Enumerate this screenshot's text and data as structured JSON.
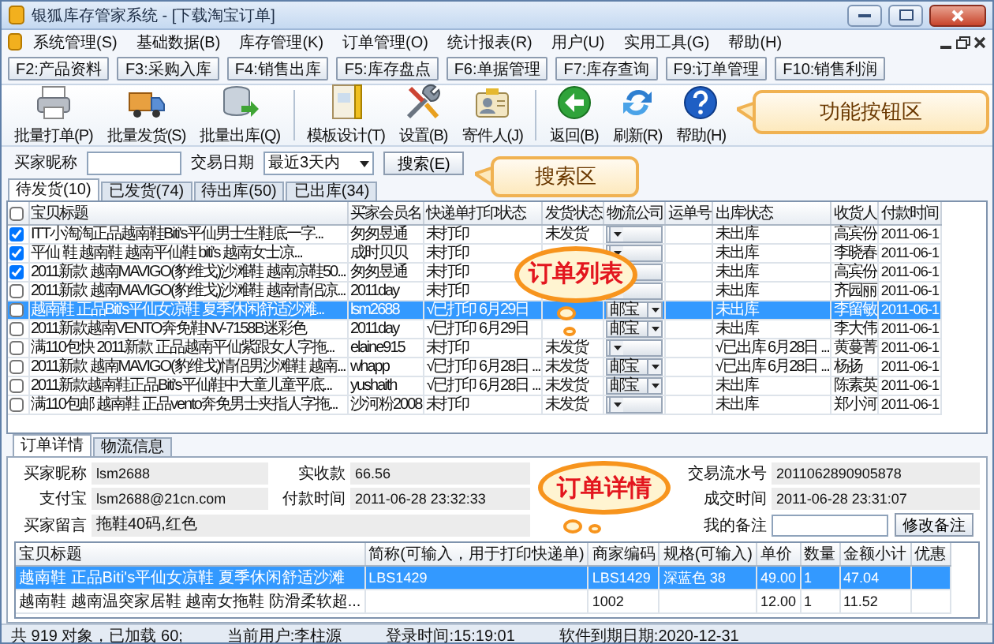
{
  "window": {
    "title": "银狐库存管家系统 - [下载淘宝订单]"
  },
  "menu": [
    "系统管理(S)",
    "基础数据(B)",
    "库存管理(K)",
    "订单管理(O)",
    "统计报表(R)",
    "用户(U)",
    "实用工具(G)",
    "帮助(H)"
  ],
  "function_keys": [
    "F2:产品资料",
    "F3:采购入库",
    "F4:销售出库",
    "F5:库存盘点",
    "F6:单据管理",
    "F7:库存查询",
    "F9:订单管理",
    "F10:销售利润"
  ],
  "toolbar": [
    [
      {
        "label": "批量打单(P)"
      },
      {
        "label": "批量发货(S)"
      },
      {
        "label": "批量出库(Q)"
      }
    ],
    [
      {
        "label": "模板设计(T)"
      },
      {
        "label": "设置(B)"
      },
      {
        "label": "寄件人(J)"
      }
    ],
    [
      {
        "label": "返回(B)"
      },
      {
        "label": "刷新(R)"
      },
      {
        "label": "帮助(H)"
      }
    ]
  ],
  "search": {
    "buyer_label": "买家昵称",
    "date_label": "交易日期",
    "date_value": "最近3天内",
    "button": "搜索(E)"
  },
  "order_tabs": [
    {
      "label": "待发货(10)",
      "selected": true
    },
    {
      "label": "已发货(74)",
      "selected": false
    },
    {
      "label": "待出库(50)",
      "selected": false
    },
    {
      "label": "已出库(34)",
      "selected": false
    }
  ],
  "orders": {
    "select_all_checked": false,
    "columns": [
      "宝贝标题",
      "买家会员名",
      "快递单打印状态",
      "发货状态",
      "物流公司",
      "运单号",
      "出库状态",
      "收货人",
      "付款时间"
    ],
    "rows": [
      {
        "checked": true,
        "selected": false,
        "title": "ITT小淘淘正品越南鞋Biti's平仙男士生鞋底一字...",
        "buyer": "匆匆昱通",
        "print_status": "未打印",
        "ship_status": "未发货",
        "outbound": "未出库",
        "receiver": "高宾份",
        "paid_time": "2011-06-1"
      },
      {
        "checked": true,
        "selected": false,
        "title": "平仙 鞋 越南鞋 越南平仙鞋 biti's 越南女士凉...",
        "buyer": "成时贝贝",
        "print_status": "未打印",
        "outbound": "未出库",
        "receiver": "李晓春",
        "paid_time": "2011-06-1"
      },
      {
        "checked": true,
        "selected": false,
        "title": "2011新款 越南MAVIGO(豹维戈)沙滩鞋 越南凉鞋50...",
        "buyer": "匆匆昱通",
        "print_status": "未打印",
        "outbound": "未出库",
        "receiver": "高宾份",
        "paid_time": "2011-06-1"
      },
      {
        "checked": false,
        "selected": false,
        "title": "2011新款 越南MAVIGO(豹维戈)沙滩鞋 越南情侣凉...",
        "buyer": "2011day",
        "print_status": "未打印",
        "outbound": "未出库",
        "receiver": "齐园丽",
        "paid_time": "2011-06-1"
      },
      {
        "checked": false,
        "selected": true,
        "title": "越南鞋 正品Biti's平仙女凉鞋 夏季休闲舒适沙滩...",
        "buyer": "lsm2688",
        "print_status": "√已打印 6月29日",
        "logistics": "邮宝",
        "outbound": "未出库",
        "receiver": "李留敏",
        "paid_time": "2011-06-1"
      },
      {
        "checked": false,
        "selected": false,
        "title": "2011新款越南VENTO奔免鞋NV-7158B迷彩色",
        "buyer": "2011day",
        "print_status": "√已打印 6月29日",
        "logistics": "邮宝",
        "outbound": "未出库",
        "receiver": "李大伟",
        "paid_time": "2011-06-1"
      },
      {
        "checked": false,
        "selected": false,
        "title": "满110包快 2011新款 正品越南平仙紫跟女人字拖...",
        "buyer": "elaine915",
        "print_status": "未打印",
        "ship_status": "未发货",
        "outbound": "√已出库 6月28日 ...",
        "receiver": "黄蔓菁",
        "paid_time": "2011-06-1"
      },
      {
        "checked": false,
        "selected": false,
        "title": "2011新款 越南MAVIGO(豹维戈)情侣男沙滩鞋 越南...",
        "buyer": "whapp",
        "print_status": "√已打印 6月28日 ...",
        "ship_status": "未发货",
        "logistics": "邮宝",
        "outbound": "√已出库 6月28日 ...",
        "receiver": "杨扬",
        "paid_time": "2011-06-1"
      },
      {
        "checked": false,
        "selected": false,
        "title": "2011新款越南鞋正品Biti's平仙鞋中大童儿童平底...",
        "buyer": "yushaith",
        "print_status": "√已打印 6月28日 ...",
        "ship_status": "未发货",
        "logistics": "邮宝",
        "outbound": "未出库",
        "receiver": "陈素英",
        "paid_time": "2011-06-1"
      },
      {
        "checked": false,
        "selected": false,
        "title": "满110包邮 越南鞋 正品vento奔免男士夹指人字拖...",
        "buyer": "沙河粉2008",
        "print_status": "未打印",
        "ship_status": "未发货",
        "outbound": "未出库",
        "receiver": "郑小河",
        "paid_time": "2011-06-1"
      }
    ]
  },
  "detail": {
    "tabs": [
      {
        "label": "订单详情",
        "selected": true
      },
      {
        "label": "物流信息",
        "selected": false
      }
    ],
    "fields": [
      {
        "label": "买家昵称",
        "value": "lsm2688"
      },
      {
        "label": "实收款",
        "value": "66.56"
      },
      {
        "label": "交易流水号",
        "value": "2011062890905878"
      },
      {
        "label": "支付宝",
        "value": "lsm2688@21cn.com"
      },
      {
        "label": "付款时间",
        "value": "2011-06-28 23:32:33"
      },
      {
        "label": "成交时间",
        "value": "2011-06-28 23:31:07"
      }
    ],
    "message": {
      "label": "买家留言",
      "value": "拖鞋40码,红色"
    },
    "remark": {
      "label": "我的备注",
      "button": "修改备注"
    },
    "items": {
      "columns": [
        "宝贝标题",
        "简称(可输入，用于打印快递单)",
        "商家编码",
        "规格(可输入)",
        "单价",
        "数量",
        "金额小计",
        "优惠"
      ],
      "rows": [
        {
          "selected": true,
          "cells": [
            "越南鞋 正品Biti's平仙女凉鞋 夏季休闲舒适沙滩",
            "LBS1429",
            "LBS1429",
            "深蓝色 38",
            "49.00",
            "1",
            "47.04"
          ]
        },
        {
          "selected": false,
          "cells": [
            "越南鞋 越南温突家居鞋 越南女拖鞋 防滑柔软超...",
            null,
            "1002",
            null,
            "12.00",
            "1",
            "11.52"
          ]
        }
      ]
    }
  },
  "status_bar": [
    "共 919 对象，已加载 60;",
    "当前用户:李柱源",
    "登录时间:15:19:01",
    "软件到期日期:2020-12-31"
  ],
  "callouts": [
    {
      "kind": "box",
      "text": "功能按钮区"
    },
    {
      "kind": "box",
      "text": "搜索区"
    },
    {
      "kind": "cloud",
      "text": "订单列表"
    },
    {
      "kind": "cloud",
      "text": "订单详情"
    }
  ]
}
